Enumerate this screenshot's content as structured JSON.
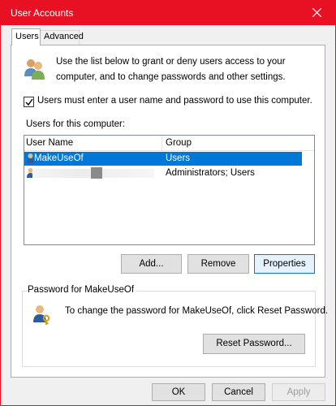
{
  "window": {
    "title": "User Accounts"
  },
  "tabs": [
    {
      "label": "Users",
      "active": true
    },
    {
      "label": "Advanced",
      "active": false
    }
  ],
  "intro": {
    "icon": "users-icon",
    "text": "Use the list below to grant or deny users access to your computer, and to change passwords and other settings."
  },
  "require_login": {
    "checked": true,
    "label": "Users must enter a user name and password to use this computer."
  },
  "users_section": {
    "label": "Users for this computer:",
    "columns": [
      "User Name",
      "Group"
    ],
    "rows": [
      {
        "name": "MakeUseOf",
        "group": "Users",
        "selected": true
      },
      {
        "name": "",
        "group": "Administrators; Users",
        "selected": false
      }
    ]
  },
  "list_buttons": {
    "add": "Add...",
    "remove": "Remove",
    "properties": "Properties"
  },
  "password_group": {
    "title": "Password for MakeUseOf",
    "icon": "user-key-icon",
    "text": "To change the password for MakeUseOf, click Reset Password.",
    "reset_button": "Reset Password..."
  },
  "footer": {
    "ok": "OK",
    "cancel": "Cancel",
    "apply": "Apply"
  },
  "colors": {
    "titlebar": "#e81123",
    "selection": "#0078d7"
  }
}
